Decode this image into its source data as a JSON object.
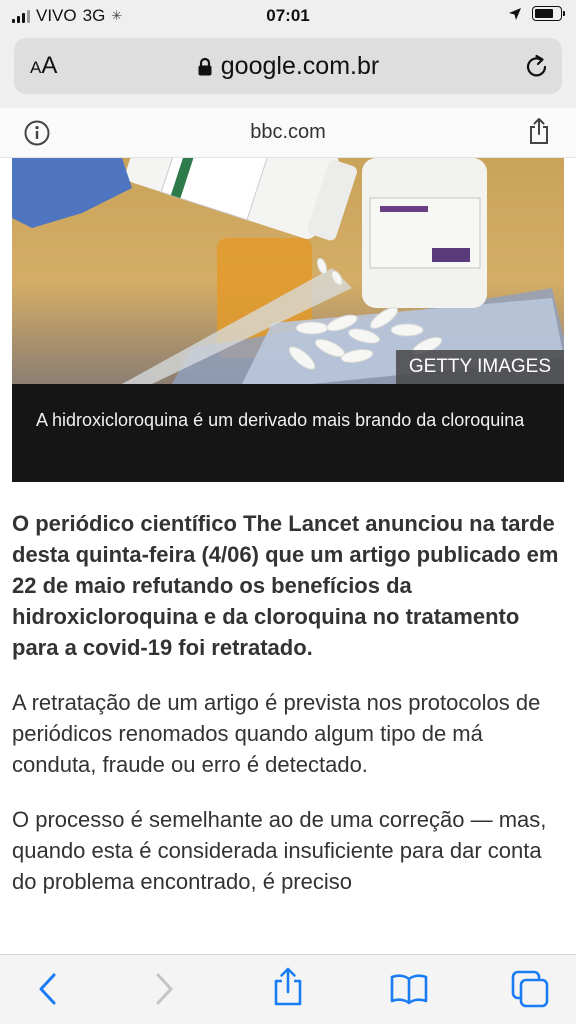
{
  "status_bar": {
    "carrier": "VIVO",
    "network": "3G",
    "time": "07:01",
    "battery_level": 0.75
  },
  "address_bar": {
    "text_size_label_small": "A",
    "text_size_label_large": "A",
    "url": "google.com.br"
  },
  "site_bar": {
    "site": "bbc.com"
  },
  "article": {
    "image_credit": "GETTY IMAGES",
    "image_caption": "A hidroxicloroquina é um derivado mais brando da cloroquina",
    "lead": "O periódico científico The Lancet anunciou na tarde desta quinta-feira (4/06) que um artigo publicado em 22 de maio refutando os benefícios da hidroxicloroquina e da cloroquina no tratamento para a covid-19 foi retratado.",
    "paragraphs": [
      "A retratação de um artigo é prevista nos protocolos de periódicos renomados quando algum tipo de má conduta, fraude ou erro é detectado.",
      "O processo é semelhante ao de uma correção — mas, quando esta é considerada insuficiente para dar conta do problema encontrado, é preciso"
    ]
  },
  "toolbar": {
    "icons": [
      "back-icon",
      "forward-icon",
      "share-icon",
      "bookmarks-icon",
      "tabs-icon"
    ]
  },
  "colors": {
    "accent": "#1a7cf5",
    "disabled": "#c4c4c4"
  }
}
